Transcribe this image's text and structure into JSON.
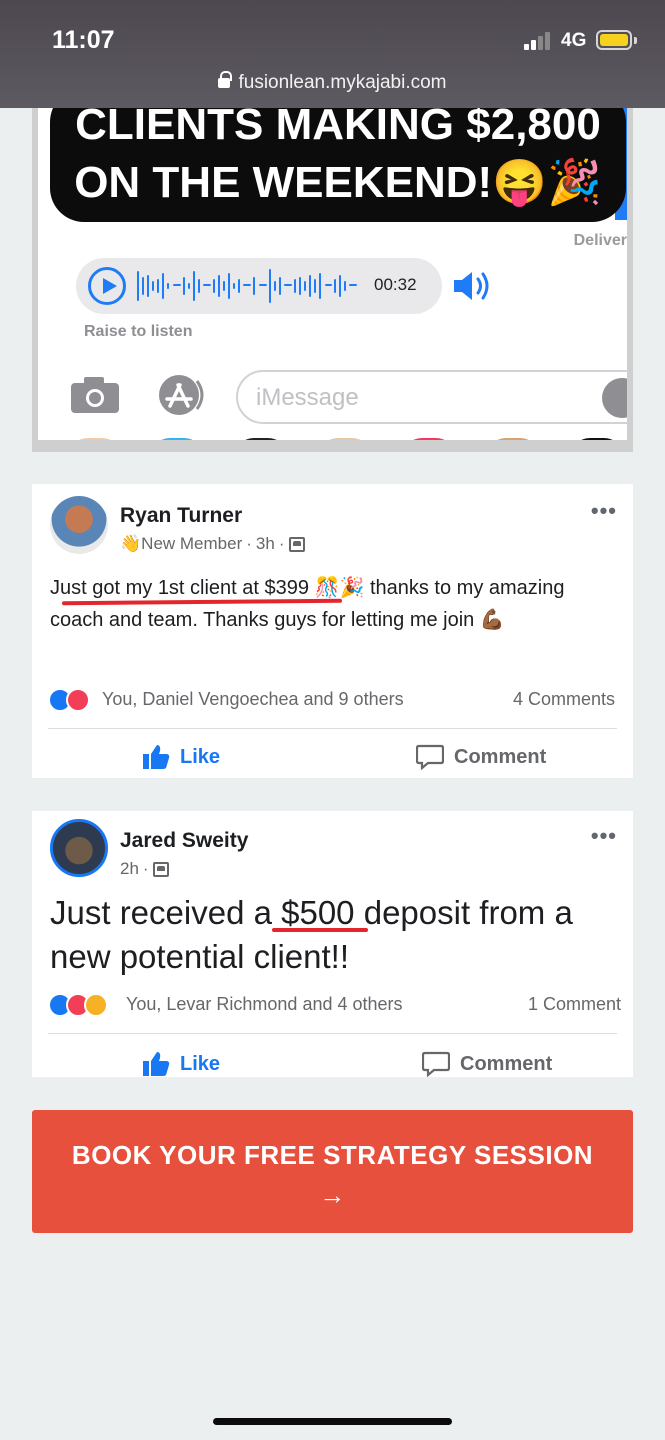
{
  "status_bar": {
    "time": "11:07",
    "network": "4G",
    "url": "fusionlean.mykajabi.com"
  },
  "imessage": {
    "headline_line1": "CLIENTS MAKING $2,800",
    "headline_line2": "ON THE WEEKEND!😝🎉",
    "delivered": "Deliver",
    "audio_duration": "00:32",
    "raise_to_listen": "Raise to listen",
    "input_placeholder": "iMessage"
  },
  "posts": [
    {
      "author": "Ryan Turner",
      "badge": "👋New Member",
      "time": "3h",
      "text_underlined": "Just got my 1st client at $399",
      "text_rest": " 🎊🎉 thanks to my amazing coach and team. Thanks guys for letting  me join 💪🏾",
      "reactions_text": "You, Daniel Vengoechea and 9 others",
      "comments": "4 Comments",
      "like_label": "Like",
      "comment_label": "Comment"
    },
    {
      "author": "Jared Sweity",
      "time": "2h",
      "text_before": "Just received a ",
      "text_underlined": "$500",
      "text_after": " deposit from a new potential client!!",
      "reactions_text": "You, Levar Richmond and 4 others",
      "comments": "1 Comment",
      "like_label": "Like",
      "comment_label": "Comment"
    }
  ],
  "cta": {
    "label": "BOOK YOUR FREE STRATEGY SESSION",
    "arrow": "→"
  }
}
